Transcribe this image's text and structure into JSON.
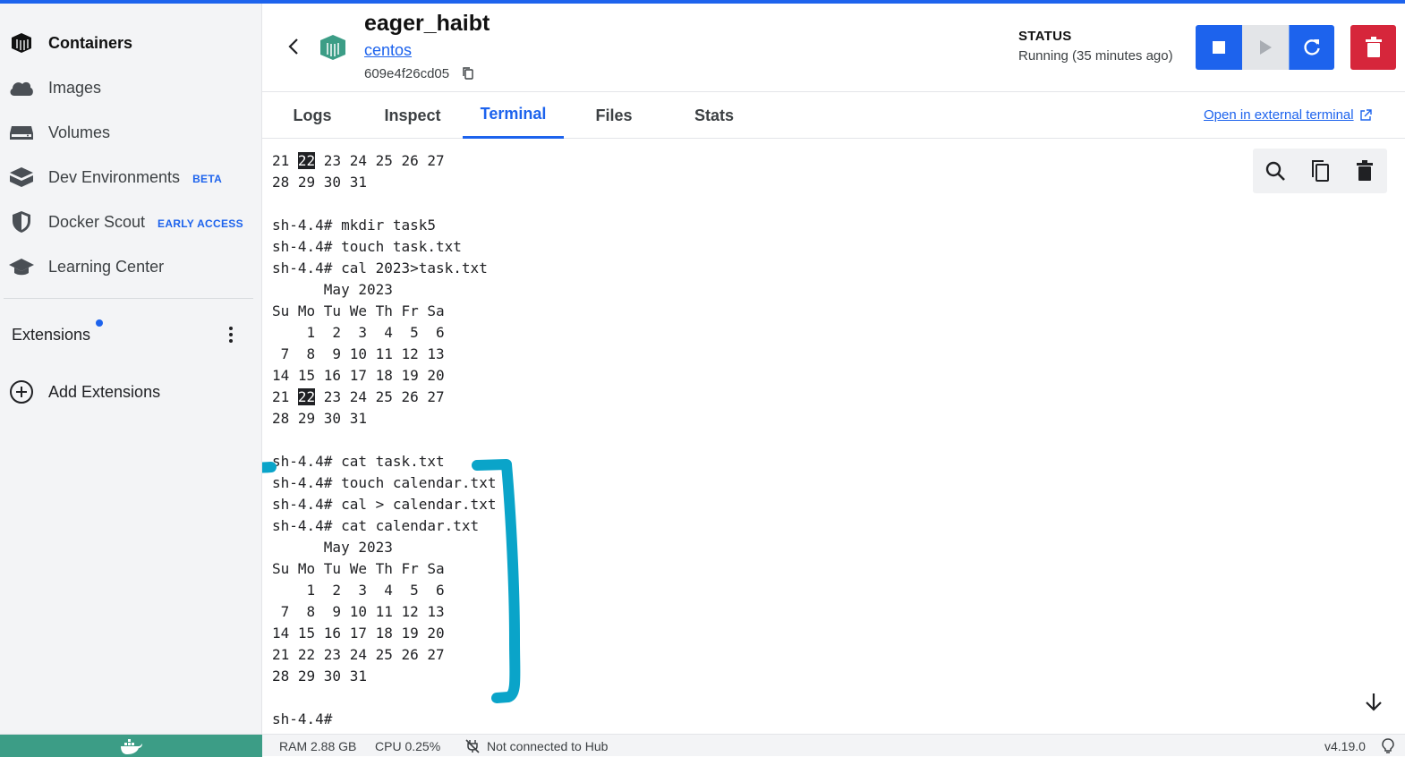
{
  "sidebar": {
    "items": [
      {
        "label": "Containers",
        "icon": "containers-icon"
      },
      {
        "label": "Images",
        "icon": "cloud-icon"
      },
      {
        "label": "Volumes",
        "icon": "volume-icon"
      },
      {
        "label": "Dev Environments",
        "icon": "dev-env-icon",
        "badge": "BETA"
      },
      {
        "label": "Docker Scout",
        "icon": "shield-icon",
        "badge": "EARLY ACCESS"
      },
      {
        "label": "Learning Center",
        "icon": "graduation-cap-icon"
      }
    ],
    "extensions_label": "Extensions",
    "add_extensions_label": "Add Extensions"
  },
  "header": {
    "container_name": "eager_haibt",
    "image_name": "centos",
    "container_id": "609e4f26cd05",
    "status_title": "STATUS",
    "status_value": "Running (35 minutes ago)"
  },
  "tabs": [
    {
      "label": "Logs"
    },
    {
      "label": "Inspect"
    },
    {
      "label": "Terminal",
      "active": true
    },
    {
      "label": "Files"
    },
    {
      "label": "Stats"
    }
  ],
  "open_external_label": "Open in external terminal",
  "terminal": {
    "lines": [
      {
        "parts": [
          {
            "t": "21 "
          },
          {
            "t": "22",
            "hl": true
          },
          {
            "t": " 23 24 25 26 27"
          }
        ]
      },
      {
        "parts": [
          {
            "t": "28 29 30 31"
          }
        ]
      },
      {
        "parts": [
          {
            "t": ""
          }
        ]
      },
      {
        "parts": [
          {
            "t": "sh-4.4# mkdir task5"
          }
        ]
      },
      {
        "parts": [
          {
            "t": "sh-4.4# touch task.txt"
          }
        ]
      },
      {
        "parts": [
          {
            "t": "sh-4.4# cal 2023>task.txt"
          }
        ]
      },
      {
        "parts": [
          {
            "t": "      May 2023"
          }
        ]
      },
      {
        "parts": [
          {
            "t": "Su Mo Tu We Th Fr Sa"
          }
        ]
      },
      {
        "parts": [
          {
            "t": "    1  2  3  4  5  6"
          }
        ]
      },
      {
        "parts": [
          {
            "t": " 7  8  9 10 11 12 13"
          }
        ]
      },
      {
        "parts": [
          {
            "t": "14 15 16 17 18 19 20"
          }
        ]
      },
      {
        "parts": [
          {
            "t": "21 "
          },
          {
            "t": "22",
            "hl": true
          },
          {
            "t": " 23 24 25 26 27"
          }
        ]
      },
      {
        "parts": [
          {
            "t": "28 29 30 31"
          }
        ]
      },
      {
        "parts": [
          {
            "t": ""
          }
        ]
      },
      {
        "parts": [
          {
            "t": "sh-4.4# cat task.txt"
          }
        ]
      },
      {
        "parts": [
          {
            "t": "sh-4.4# touch calendar.txt"
          }
        ]
      },
      {
        "parts": [
          {
            "t": "sh-4.4# cal > calendar.txt"
          }
        ]
      },
      {
        "parts": [
          {
            "t": "sh-4.4# cat calendar.txt"
          }
        ]
      },
      {
        "parts": [
          {
            "t": "      May 2023"
          }
        ]
      },
      {
        "parts": [
          {
            "t": "Su Mo Tu We Th Fr Sa"
          }
        ]
      },
      {
        "parts": [
          {
            "t": "    1  2  3  4  5  6"
          }
        ]
      },
      {
        "parts": [
          {
            "t": " 7  8  9 10 11 12 13"
          }
        ]
      },
      {
        "parts": [
          {
            "t": "14 15 16 17 18 19 20"
          }
        ]
      },
      {
        "parts": [
          {
            "t": "21 22 23 24 25 26 27"
          }
        ]
      },
      {
        "parts": [
          {
            "t": "28 29 30 31"
          }
        ]
      },
      {
        "parts": [
          {
            "t": ""
          }
        ]
      },
      {
        "parts": [
          {
            "t": "sh-4.4# "
          }
        ]
      }
    ]
  },
  "footer": {
    "ram": "RAM 2.88 GB",
    "cpu": "CPU 0.25%",
    "hub_status": "Not connected to Hub",
    "version": "v4.19.0"
  },
  "colors": {
    "accent": "#1d63ed",
    "danger": "#d6263b",
    "annotation": "#0aa4c9",
    "footer_whale_bg": "#3c9d86"
  }
}
